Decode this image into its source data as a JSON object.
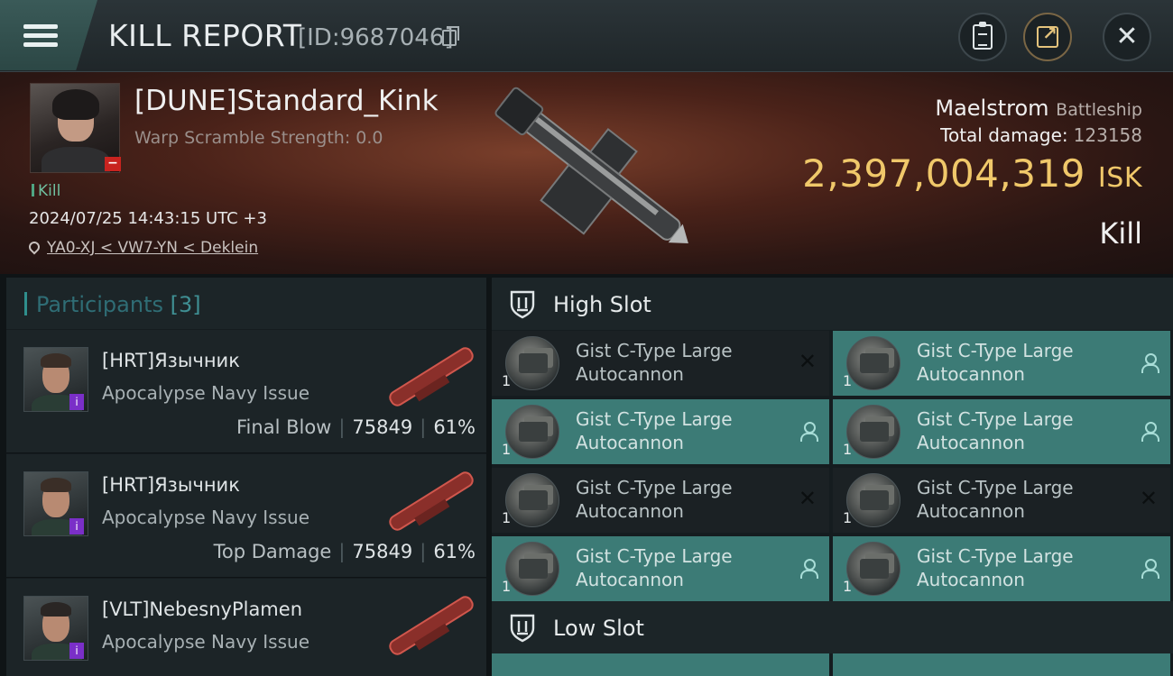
{
  "header": {
    "title": "KILL REPORT",
    "report_id": "[ID:9687046]"
  },
  "victim": {
    "name": "[DUNE]Standard_Kink",
    "warp_scramble": "Warp Scramble Strength: 0.0",
    "tag": "Kill",
    "timestamp": "2024/07/25 14:43:15 UTC +3",
    "location": "YA0-XJ < VW7-YN < Deklein",
    "ship_name": "Maelstrom",
    "ship_class": "Battleship",
    "total_damage_label": "Total damage:",
    "total_damage": "123158",
    "isk_value": "2,397,004,319",
    "isk_unit": "ISK",
    "result": "Kill"
  },
  "participants": {
    "title": "Participants",
    "count": "[3]",
    "items": [
      {
        "name": "[HRT]Язычник",
        "ship": "Apocalypse Navy Issue",
        "label": "Final Blow",
        "damage": "75849",
        "percent": "61%"
      },
      {
        "name": "[HRT]Язычник",
        "ship": "Apocalypse Navy Issue",
        "label": "Top Damage",
        "damage": "75849",
        "percent": "61%"
      },
      {
        "name": "[VLT]NebesnyPlamen",
        "ship": "Apocalypse Navy Issue"
      }
    ]
  },
  "slots": {
    "high_label": "High Slot",
    "low_label": "Low Slot",
    "high_items": [
      {
        "name": "Gist C-Type Large Autocannon",
        "qty": "1",
        "status": "destroyed"
      },
      {
        "name": "Gist C-Type Large Autocannon",
        "qty": "1",
        "status": "dropped"
      },
      {
        "name": "Gist C-Type Large Autocannon",
        "qty": "1",
        "status": "dropped"
      },
      {
        "name": "Gist C-Type Large Autocannon",
        "qty": "1",
        "status": "dropped"
      },
      {
        "name": "Gist C-Type Large Autocannon",
        "qty": "1",
        "status": "destroyed"
      },
      {
        "name": "Gist C-Type Large Autocannon",
        "qty": "1",
        "status": "destroyed"
      },
      {
        "name": "Gist C-Type Large Autocannon",
        "qty": "1",
        "status": "dropped"
      },
      {
        "name": "Gist C-Type Large Autocannon",
        "qty": "1",
        "status": "dropped"
      }
    ]
  },
  "colors": {
    "accent_teal": "#3c7b76",
    "isk_gold": "#f0c86a",
    "destroyed_bg": "#1b2124"
  },
  "icons": {
    "menu": "hamburger-icon",
    "copy": "copy-icon",
    "clipboard": "clipboard-icon",
    "share": "share-icon",
    "close": "close-icon",
    "location": "location-pin-icon",
    "slot": "shield-icon",
    "destroyed": "x-icon",
    "dropped": "person-icon"
  }
}
